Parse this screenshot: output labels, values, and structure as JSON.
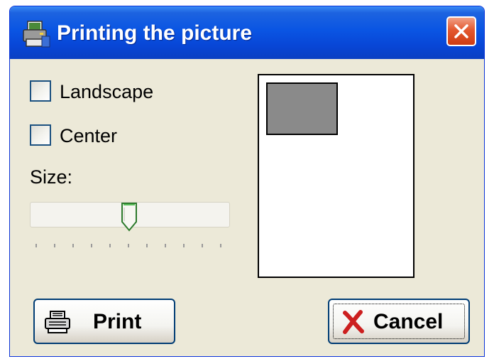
{
  "window": {
    "title": "Printing the picture",
    "title_color": "#ffffff",
    "titlebar_color": "#0a55e3",
    "body_color": "#ece9d8"
  },
  "icons": {
    "app": "printer-picture-icon",
    "close": "close-icon",
    "print": "printer-icon",
    "cancel": "red-x-icon"
  },
  "options": {
    "landscape": {
      "label": "Landscape",
      "checked": false
    },
    "center": {
      "label": "Center",
      "checked": false
    }
  },
  "size": {
    "label": "Size:",
    "slider_value": 0.5,
    "tick_count": 11
  },
  "preview": {
    "page_color": "#ffffff",
    "picture_color": "#8a8a8a"
  },
  "buttons": {
    "print_label": "Print",
    "cancel_label": "Cancel",
    "cancel_icon_color": "#cc1f1f"
  }
}
